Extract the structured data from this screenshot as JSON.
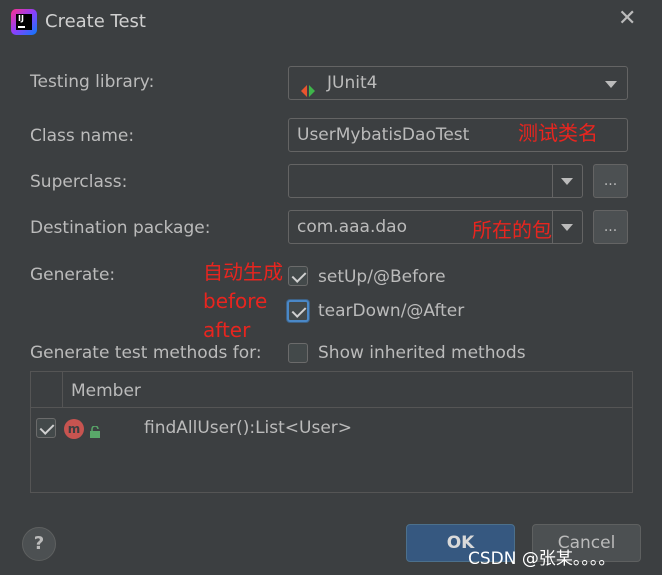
{
  "dialog": {
    "title": "Create Test",
    "close_glyph": "✕"
  },
  "form": {
    "testing_library_label": "Testing library:",
    "testing_library_value": "JUnit4",
    "class_name_label": "Class name:",
    "class_name_value": "UserMybatisDaoTest",
    "superclass_label": "Superclass:",
    "superclass_value": "",
    "destination_package_label": "Destination package:",
    "destination_package_value": "com.aaa.dao",
    "browse_label": "...",
    "generate_label": "Generate:",
    "setup_label": "setUp/@Before",
    "setup_checked": true,
    "teardown_label": "tearDown/@After",
    "teardown_checked": true,
    "generate_methods_label": "Generate test methods for:",
    "show_inherited_label": "Show inherited methods",
    "show_inherited_checked": false
  },
  "table": {
    "header_member": "Member",
    "rows": [
      {
        "checked": true,
        "method_badge": "m",
        "signature": "findAllUser():List<User>"
      }
    ]
  },
  "buttons": {
    "ok_label": "OK",
    "cancel_label": "Cancel",
    "help_label": "?"
  },
  "annotations": {
    "class_name_note": "测试类名",
    "package_note": "所在的包",
    "generate_note_line1": "自动生成",
    "generate_note_line2": "before",
    "generate_note_line3": "after"
  },
  "watermark": "CSDN @张某。。。。",
  "colors": {
    "background": "#3c3f41",
    "text": "#bbbbbb",
    "annotation_red": "#e8251f",
    "ok_button": "#365880",
    "focus_blue": "#4a88c7"
  }
}
